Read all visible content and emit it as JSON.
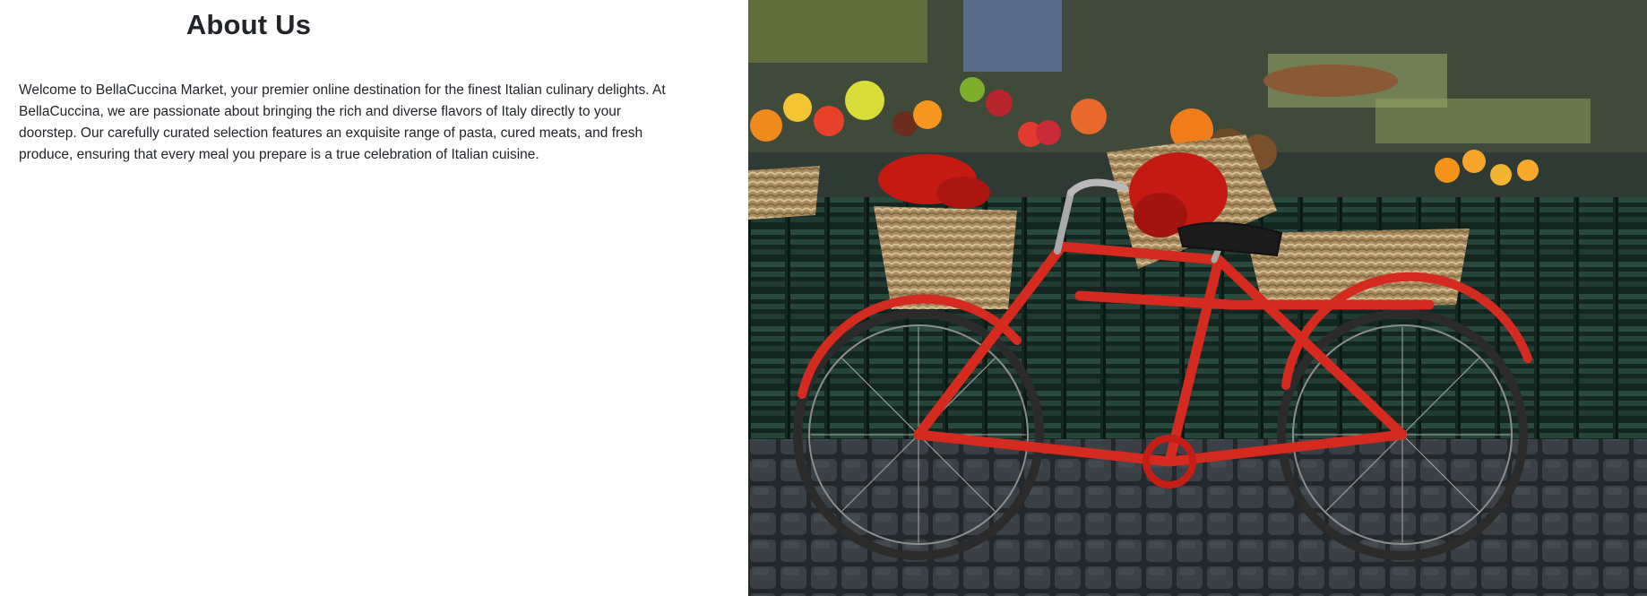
{
  "about": {
    "title": "About Us",
    "body": "Welcome to BellaCuccina Market, your premier online destination for the finest Italian culinary delights. At BellaCuccina, we are passionate about bringing the rich and diverse flavors of Italy directly to your doorstep. Our carefully curated selection features an exquisite range of pasta, cured meats, and fresh produce, ensuring that every meal you prepare is a true celebration of Italian cuisine."
  },
  "image": {
    "subject": "red bicycle with produce baskets at a market stall",
    "colors": {
      "bike": "#d42a20",
      "cobblestone": "#2b3034",
      "crates": "#1f3a30",
      "wicker": "#b89a6c",
      "chili": "#c41a12"
    }
  }
}
